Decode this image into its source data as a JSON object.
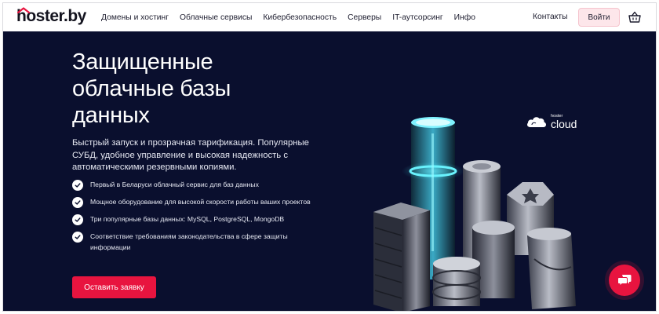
{
  "header": {
    "logo_text": "hoster.by",
    "nav": [
      "Домены и хостинг",
      "Облачные сервисы",
      "Кибербезопасность",
      "Серверы",
      "IT-аутсорсинг",
      "Инфо"
    ],
    "contacts_label": "Контакты",
    "login_label": "Войти",
    "cart_icon": "basket-icon"
  },
  "hero": {
    "title": "Защищенные облачные базы данных",
    "description": "Быстрый запуск и прозрачная тарификация. Популярные СУБД, удобное управление и высокая надежность с автоматическими резервными копиями.",
    "features": [
      "Первый в Беларуси облачный сервис для баз данных",
      "Мощное оборудование для высокой скорости работы ваших проектов",
      "Три популярные базы данных: MySQL, PostgreSQL, MongoDB",
      "Соответствие требованиям законодательства в сфере защиты информации"
    ],
    "cta_label": "Оставить заявку",
    "brand_small": "hoster",
    "brand_text": "cloud",
    "chat_icon": "chat-icon"
  },
  "colors": {
    "accent": "#e8143f",
    "hero_bg": "#0a0f2e",
    "login_bg": "#fde6ea",
    "glow": "#3fe3f0"
  }
}
